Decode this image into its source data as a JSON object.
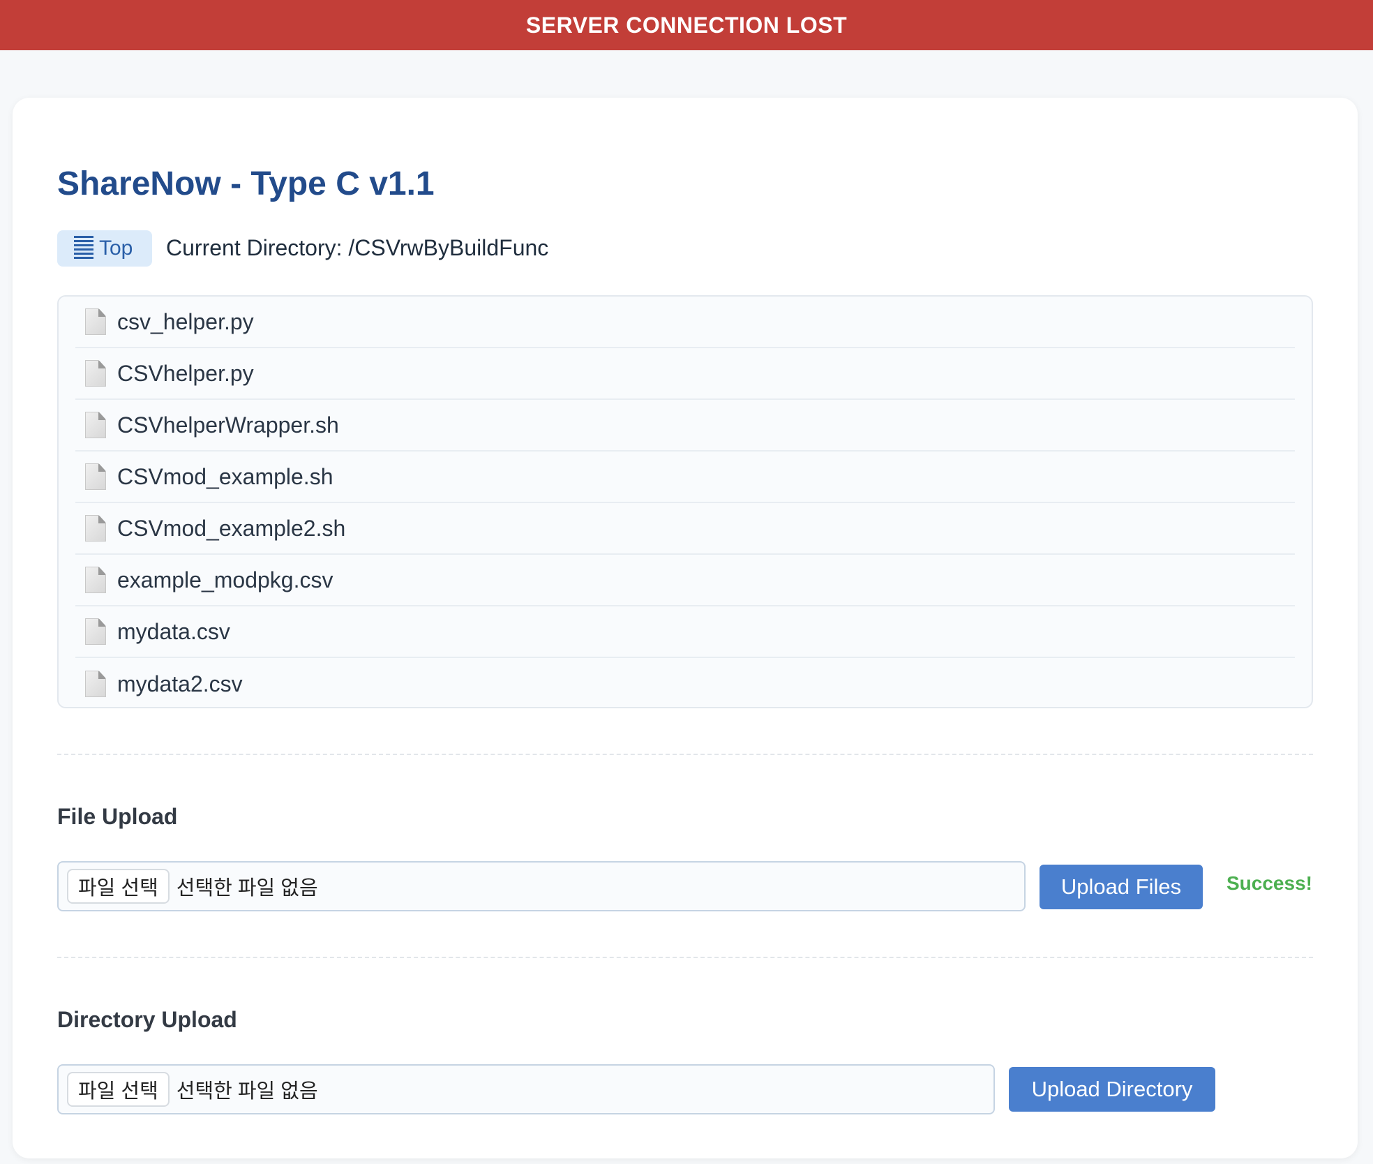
{
  "banner": {
    "text": "SERVER CONNECTION LOST",
    "color": "#c23e38"
  },
  "app": {
    "title": "ShareNow - Type C v1.1",
    "title_color": "#224b8b"
  },
  "nav": {
    "top_label": "Top",
    "top_icon": "list-icon",
    "current_directory": "Current Directory: /CSVrwByBuildFunc"
  },
  "files": [
    {
      "name": "csv_helper.py",
      "icon": "file-icon"
    },
    {
      "name": "CSVhelper.py",
      "icon": "file-icon"
    },
    {
      "name": "CSVhelperWrapper.sh",
      "icon": "file-icon"
    },
    {
      "name": "CSVmod_example.sh",
      "icon": "file-icon"
    },
    {
      "name": "CSVmod_example2.sh",
      "icon": "file-icon"
    },
    {
      "name": "example_modpkg.csv",
      "icon": "file-icon"
    },
    {
      "name": "mydata.csv",
      "icon": "file-icon"
    },
    {
      "name": "mydata2.csv",
      "icon": "file-icon"
    }
  ],
  "file_upload": {
    "title": "File Upload",
    "choose_label": "파일 선택",
    "no_file_text": "선택한 파일 없음",
    "button_label": "Upload Files",
    "status_text": "Success!",
    "status_color": "#4caf50"
  },
  "directory_upload": {
    "title": "Directory Upload",
    "choose_label": "파일 선택",
    "no_file_text": "선택한 파일 없음",
    "button_label": "Upload Directory"
  },
  "colors": {
    "accent": "#4a7fce",
    "top_button_bg": "#dcebfa"
  }
}
